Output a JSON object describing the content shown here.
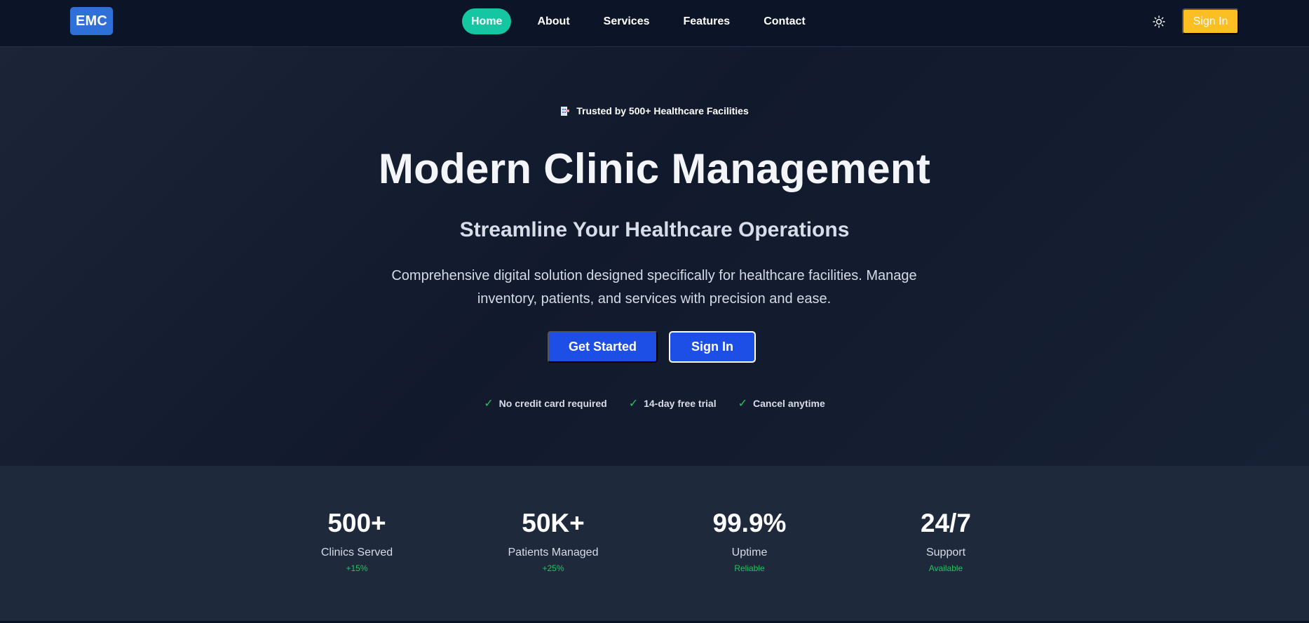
{
  "nav": {
    "logo": "EMC",
    "links": [
      "Home",
      "About",
      "Services",
      "Features",
      "Contact"
    ],
    "active": "Home",
    "theme_icon": "sun-icon",
    "signin_label": "Sign In"
  },
  "hero": {
    "trust_icon": "clinic-building-icon",
    "trust_text": "Trusted by 500+ Healthcare Facilities",
    "title": "Modern Clinic Management",
    "subtitle": "Streamline Your Healthcare Operations",
    "description": "Comprehensive digital solution designed specifically for healthcare facilities. Manage inventory, patients, and services with precision and ease.",
    "primary_cta": "Get Started",
    "secondary_cta": "Sign In",
    "perks": [
      "No credit card required",
      "14-day free trial",
      "Cancel anytime"
    ]
  },
  "stats": [
    {
      "value": "500+",
      "label": "Clinics Served",
      "change": "+15%"
    },
    {
      "value": "50K+",
      "label": "Patients Managed",
      "change": "+25%"
    },
    {
      "value": "99.9%",
      "label": "Uptime",
      "change": "Reliable"
    },
    {
      "value": "24/7",
      "label": "Support",
      "change": "Available"
    }
  ],
  "colors": {
    "background": "#0b1426",
    "active_nav": "#14c7a2",
    "signin_nav": "#fbbf24",
    "primary_button": "#1d4ee6",
    "success": "#22c55e",
    "stats_band": "#1e293c"
  }
}
